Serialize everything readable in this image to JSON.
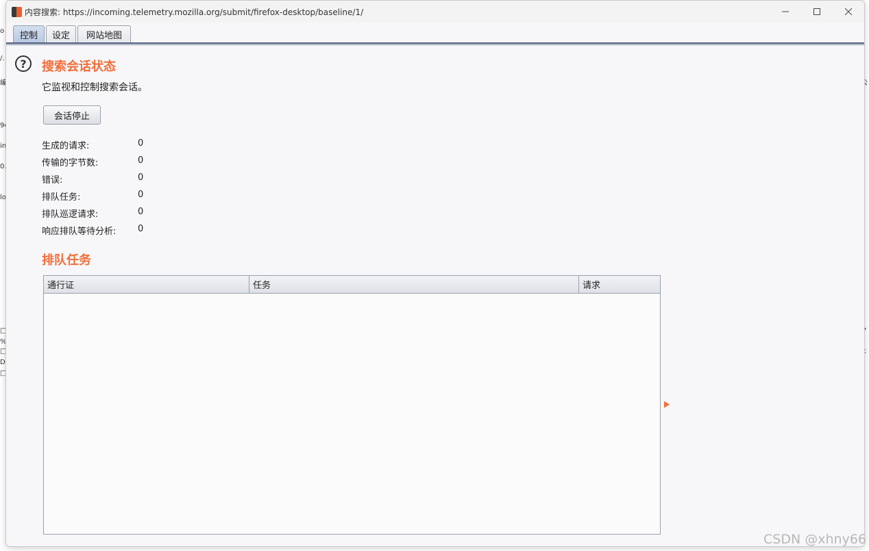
{
  "window": {
    "title": "内容搜索: https://incoming.telemetry.mozilla.org/submit/firefox-desktop/baseline/1/"
  },
  "tabs": [
    {
      "label": "控制",
      "active": true
    },
    {
      "label": "设定",
      "active": false
    },
    {
      "label": "网站地图",
      "active": false
    }
  ],
  "session": {
    "title": "搜索会话状态",
    "description": "它监视和控制搜索会话。",
    "stop_button": "会话停止"
  },
  "stats": [
    {
      "label": "生成的请求:",
      "value": "0"
    },
    {
      "label": "传输的字节数:",
      "value": "0"
    },
    {
      "label": "错误:",
      "value": "0"
    },
    {
      "label": "排队任务:",
      "value": "0"
    },
    {
      "label": "排队巡逻请求:",
      "value": "0"
    },
    {
      "label": "响应排队等待分析:",
      "value": "0"
    }
  ],
  "queue": {
    "title": "排队任务",
    "columns": [
      "通行证",
      "任务",
      "请求"
    ]
  },
  "watermark": "CSDN @xhny66",
  "colors": {
    "accent": "#f26f3a",
    "active_tab": "#c5d3ea"
  }
}
